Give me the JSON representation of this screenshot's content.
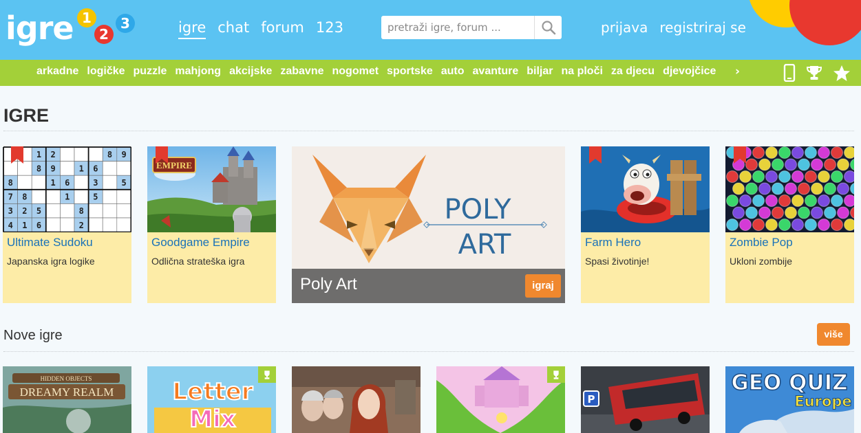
{
  "header": {
    "logo_text": "igre",
    "logo_numbers": [
      "1",
      "2",
      "3"
    ],
    "nav": [
      {
        "label": "igre",
        "active": true
      },
      {
        "label": "chat",
        "active": false
      },
      {
        "label": "forum",
        "active": false
      },
      {
        "label": "123",
        "active": false
      }
    ],
    "search_placeholder": "pretraži igre, forum ...",
    "auth": {
      "login": "prijava",
      "register": "registriraj se"
    }
  },
  "categories": [
    "arkadne",
    "logičke",
    "puzzle",
    "mahjong",
    "akcijske",
    "zabavne",
    "nogomet",
    "sportske",
    "auto",
    "avanture",
    "biljar",
    "na ploči",
    "za djecu",
    "djevojčice"
  ],
  "category_more": "›",
  "category_icons": [
    "mobile-icon",
    "trophy-icon",
    "star-icon"
  ],
  "section_games": {
    "heading": "IGRE",
    "cards": [
      {
        "title": "Ultimate Sudoku",
        "desc": "Japanska igra logike"
      },
      {
        "title": "Goodgame Empire",
        "desc": "Odlična strateška igra"
      },
      {
        "title": "Farm Hero",
        "desc": "Spasi životinje!"
      },
      {
        "title": "Zombie Pop",
        "desc": "Ukloni zombije"
      }
    ],
    "feature": {
      "title": "Poly Art",
      "button": "igraj",
      "image_text_1": "POLY",
      "image_text_2": "ART"
    },
    "thumb_texts": {
      "empire": "EMPIRE"
    }
  },
  "section_new": {
    "heading": "Nove igre",
    "more_button": "više",
    "thumb_texts": {
      "dreamy_1": "HIDDEN OBJECTS",
      "dreamy_2": "DREAMY REALM",
      "letter_1": "Letter",
      "letter_2": "Mix",
      "geo_1": "GEO QUIZ",
      "geo_2": "Europe",
      "bus_sign": "P"
    }
  },
  "sudoku_rows": [
    [
      "",
      "",
      "1",
      "2",
      "",
      "",
      "",
      "8",
      "9"
    ],
    [
      "",
      "",
      "8",
      "9",
      "",
      "1",
      "6",
      "",
      ""
    ],
    [
      "8",
      "",
      "",
      "1",
      "6",
      "",
      "3",
      "",
      "5"
    ],
    [
      "7",
      "8",
      "",
      "",
      "1",
      "",
      "5",
      "",
      ""
    ],
    [
      "3",
      "2",
      "5",
      "",
      "",
      "8",
      "",
      "",
      ""
    ],
    [
      "4",
      "1",
      "6",
      "",
      "",
      "2",
      "",
      "",
      ""
    ]
  ],
  "colors": {
    "header_bg": "#5bc3f2",
    "catbar_bg": "#a3d039",
    "card_bg": "#fdeca7",
    "title_blue": "#1a72b8",
    "button_orange": "#f0882e",
    "ribbon_red": "#e23a2e"
  }
}
